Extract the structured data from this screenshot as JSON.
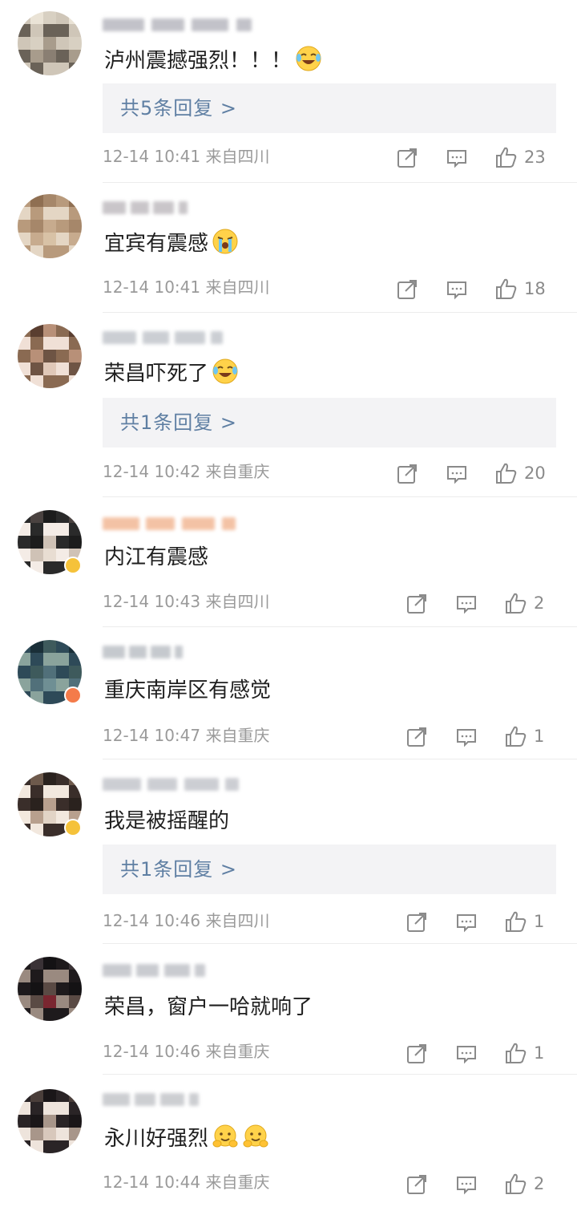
{
  "comments": [
    {
      "text": "泸州震撼强烈！！！",
      "emoji": "laugh-cry",
      "replies": "共5条回复 >",
      "time": "12-14 10:41",
      "from": "来自四川",
      "likes": "23"
    },
    {
      "text": "宜宾有震感",
      "emoji": "loud-cry",
      "replies": null,
      "time": "12-14 10:41",
      "from": "来自四川",
      "likes": "18"
    },
    {
      "text": "荣昌吓死了",
      "emoji": "laugh-cry",
      "replies": "共1条回复 >",
      "time": "12-14 10:42",
      "from": "来自重庆",
      "likes": "20"
    },
    {
      "text": "内江有震感",
      "emoji": null,
      "replies": null,
      "time": "12-14 10:43",
      "from": "来自四川",
      "likes": "2"
    },
    {
      "text": "重庆南岸区有感觉",
      "emoji": null,
      "replies": null,
      "time": "12-14 10:47",
      "from": "来自重庆",
      "likes": "1"
    },
    {
      "text": "我是被摇醒的",
      "emoji": null,
      "replies": "共1条回复 >",
      "time": "12-14 10:46",
      "from": "来自四川",
      "likes": "1"
    },
    {
      "text": "荣昌，窗户一哈就响了",
      "emoji": null,
      "replies": null,
      "time": "12-14 10:46",
      "from": "来自重庆",
      "likes": "1"
    },
    {
      "text": "永川好强烈",
      "emoji": "hug-double",
      "replies": null,
      "time": "12-14 10:44",
      "from": "来自重庆",
      "likes": "2"
    }
  ],
  "colors": {
    "link": "#5f7fa3",
    "meta": "#9a9a9a",
    "reply_bg": "#f3f3f5",
    "icon": "#8a8a8a",
    "divider": "#ececec",
    "badge_yellow": "#f5c23a",
    "badge_orange": "#f47b4a"
  }
}
